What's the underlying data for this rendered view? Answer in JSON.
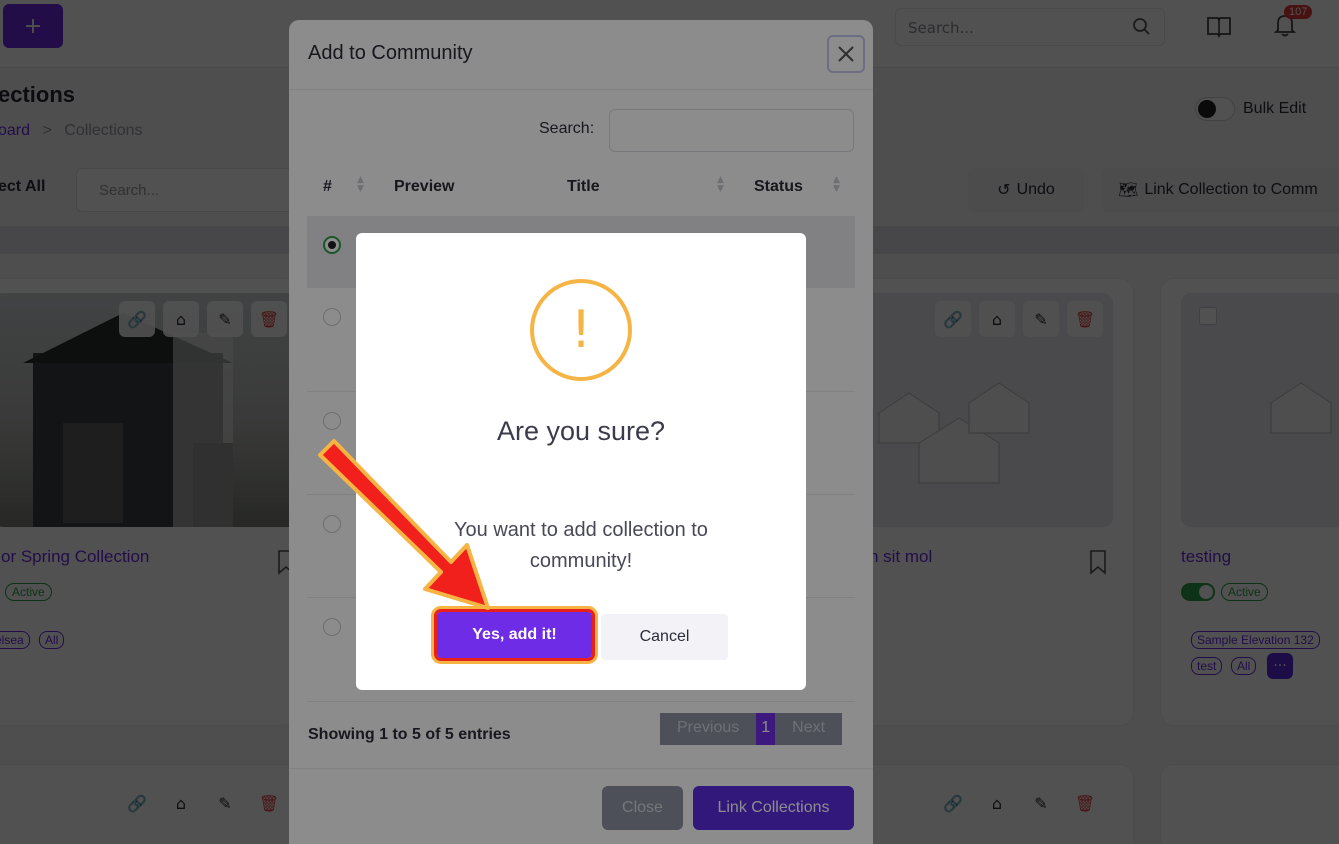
{
  "topbar": {
    "plus_label": "+",
    "search_placeholder": "Search...",
    "notification_count": "107"
  },
  "page": {
    "title": "ections",
    "breadcrumb_home": "oard",
    "breadcrumb_sep": ">",
    "breadcrumb_current": "Collections",
    "bulk_edit_label": "Bulk Edit",
    "select_all_label": "ect All",
    "search_placeholder": "Search...",
    "undo_label": "Undo",
    "link_collection_label": "Link Collection to Comm"
  },
  "cards": [
    {
      "title": "or Spring Collection",
      "status": "Active",
      "chips": [
        "elsea",
        "All"
      ]
    },
    {
      "title": "n sit mol"
    },
    {
      "title": "testing",
      "status": "Active",
      "chips": [
        "Sample Elevation 132",
        "test",
        "All"
      ],
      "more": "···"
    }
  ],
  "modal": {
    "title": "Add to Community",
    "search_label": "Search:",
    "columns": [
      "#",
      "Preview",
      "Title",
      "Status"
    ],
    "showing_text": "Showing 1 to 5 of 5 entries",
    "pager": {
      "previous": "Previous",
      "current": "1",
      "next": "Next"
    },
    "close_label": "Close",
    "link_label": "Link Collections"
  },
  "dialog": {
    "icon_glyph": "!",
    "title": "Are you sure?",
    "text": "You want to add collection to community!",
    "confirm_label": "Yes, add it!",
    "cancel_label": "Cancel"
  },
  "colors": {
    "brand": "#6f2ce6",
    "warning": "#f6b444",
    "highlight_red": "#e8201b",
    "active_green": "#2e9e4a"
  }
}
